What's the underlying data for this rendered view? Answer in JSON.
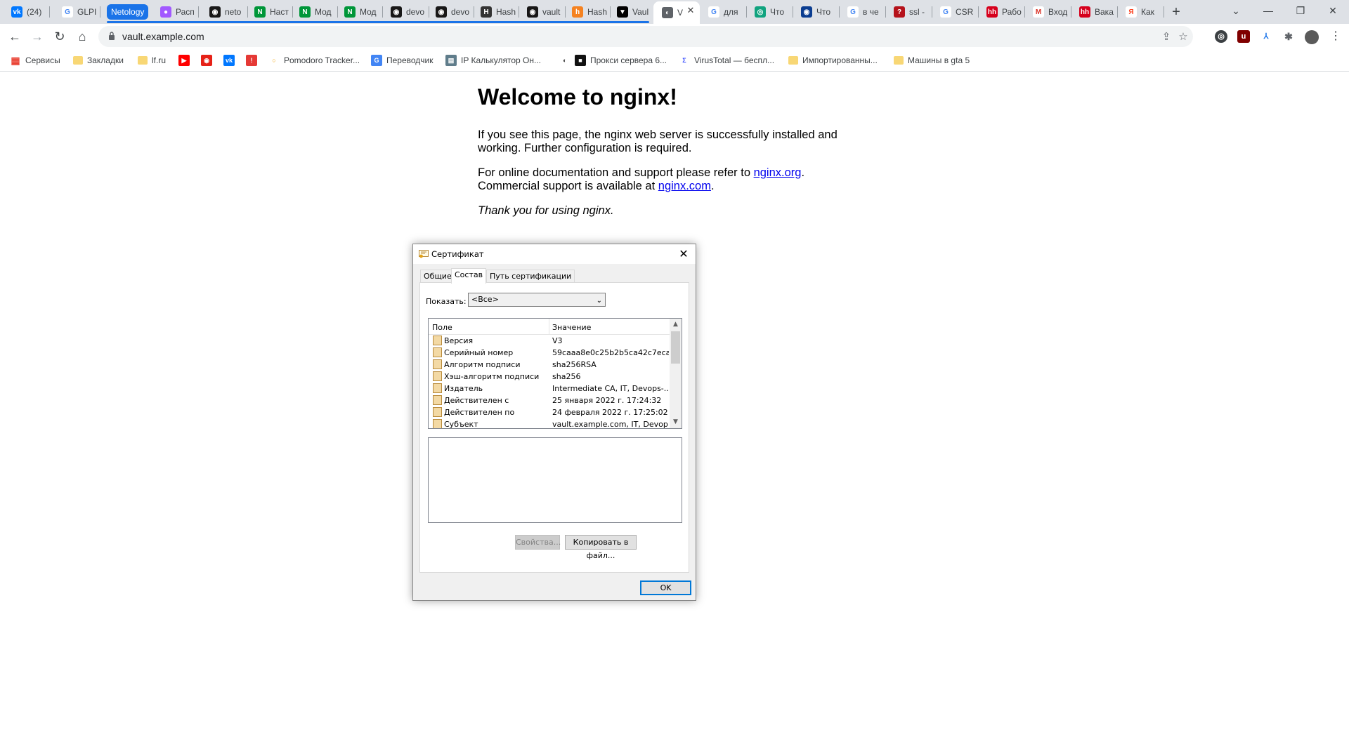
{
  "browser": {
    "tabs": [
      {
        "label": "(24)",
        "icon": "vk-icon",
        "color": "#0077ff",
        "glyph": "vk"
      },
      {
        "label": "GLPI",
        "icon": "google-icon",
        "color": "#ffffff",
        "glyph": "G"
      },
      {
        "label": "Расп",
        "icon": "figma-icon",
        "color": "#a259ff",
        "glyph": "●"
      },
      {
        "label": "neto",
        "icon": "github-icon",
        "color": "#181717",
        "glyph": "◉"
      },
      {
        "label": "Наст",
        "icon": "nginx-icon",
        "color": "#009639",
        "glyph": "N"
      },
      {
        "label": "Мод",
        "icon": "nginx-icon",
        "color": "#009639",
        "glyph": "N"
      },
      {
        "label": "Мод",
        "icon": "nginx-icon",
        "color": "#009639",
        "glyph": "N"
      },
      {
        "label": "devo",
        "icon": "github-icon",
        "color": "#181717",
        "glyph": "◉"
      },
      {
        "label": "devo",
        "icon": "github-icon",
        "color": "#181717",
        "glyph": "◉"
      },
      {
        "label": "Hash",
        "icon": "hashicorp-icon",
        "color": "#333333",
        "glyph": "H"
      },
      {
        "label": "vault",
        "icon": "github-icon",
        "color": "#181717",
        "glyph": "◉"
      },
      {
        "label": "Hash",
        "icon": "habr-icon",
        "color": "#f58220",
        "glyph": "h"
      },
      {
        "label": "Vaul",
        "icon": "vault-icon",
        "color": "#000000",
        "glyph": "▼"
      },
      {
        "label": "V",
        "icon": "globe-icon",
        "color": "#5f6368",
        "glyph": "◐",
        "active": true
      },
      {
        "label": "для",
        "icon": "google-icon",
        "color": "#ffffff",
        "glyph": "G"
      },
      {
        "label": "Что",
        "icon": "chatgpt-icon",
        "color": "#10a37f",
        "glyph": "◎"
      },
      {
        "label": "Что",
        "icon": "eye-icon",
        "color": "#0b3d91",
        "glyph": "◉"
      },
      {
        "label": "в че",
        "icon": "google-icon",
        "color": "#ffffff",
        "glyph": "G"
      },
      {
        "label": "ssl -",
        "icon": "question-icon",
        "color": "#b5121b",
        "glyph": "?"
      },
      {
        "label": "CSR",
        "icon": "google-icon",
        "color": "#ffffff",
        "glyph": "G"
      },
      {
        "label": "Рабо",
        "icon": "hh-icon",
        "color": "#d6001c",
        "glyph": "hh"
      },
      {
        "label": "Вход",
        "icon": "gmail-icon",
        "color": "#ffffff",
        "glyph": "M"
      },
      {
        "label": "Вака",
        "icon": "hh-icon",
        "color": "#d6001c",
        "glyph": "hh"
      },
      {
        "label": "Как",
        "icon": "yandex-icon",
        "color": "#ffffff",
        "glyph": "Я"
      }
    ],
    "group_label": "Netology",
    "url": "vault.example.com",
    "bookmarks": [
      {
        "label": "Сервисы",
        "icon": "apps-grid-icon"
      },
      {
        "label": "Закладки",
        "icon": "folder-icon"
      },
      {
        "label": "lf.ru",
        "icon": "folder-icon"
      },
      {
        "label": "",
        "icon": "youtube-icon"
      },
      {
        "label": "",
        "icon": "play-icon"
      },
      {
        "label": "",
        "icon": "vk-icon"
      },
      {
        "label": "",
        "icon": "alert-icon"
      },
      {
        "label": "Pomodoro Tracker...",
        "icon": "pomodoro-icon"
      },
      {
        "label": "Переводчик",
        "icon": "translate-icon"
      },
      {
        "label": "IP Калькулятор Он...",
        "icon": "network-icon"
      },
      {
        "label": "",
        "icon": "globe-icon"
      },
      {
        "label": "Прокси сервера 6...",
        "icon": "proxy-icon"
      },
      {
        "label": "VirusTotal — беспл...",
        "icon": "virustotal-icon"
      },
      {
        "label": "Импортированны...",
        "icon": "folder-icon"
      },
      {
        "label": "Машины в gta 5",
        "icon": "folder-icon"
      }
    ]
  },
  "page": {
    "title": "Welcome to nginx!",
    "p1": "If you see this page, the nginx web server is successfully installed and working. Further configuration is required.",
    "p2_before": "For online documentation and support please refer to ",
    "p2_link1": "nginx.org",
    "p2_mid": ". Commercial support is available at ",
    "p2_link2": "nginx.com",
    "p2_after": ".",
    "p3": "Thank you for using nginx."
  },
  "dialog": {
    "title": "Сертификат",
    "tabs": [
      "Общие",
      "Состав",
      "Путь сертификации"
    ],
    "active_tab": "Состав",
    "show_label": "Показать:",
    "show_value": "<Все>",
    "columns": {
      "field": "Поле",
      "value": "Значение"
    },
    "rows": [
      {
        "field": "Версия",
        "value": "V3"
      },
      {
        "field": "Серийный номер",
        "value": "59caaa8e0c25b2b5ca42c7eca..."
      },
      {
        "field": "Алгоритм подписи",
        "value": "sha256RSA"
      },
      {
        "field": "Хэш-алгоритм подписи",
        "value": "sha256"
      },
      {
        "field": "Издатель",
        "value": "Intermediate CA, IT, Devops-..."
      },
      {
        "field": "Действителен с",
        "value": "25 января 2022 г. 17:24:32"
      },
      {
        "field": "Действителен по",
        "value": "24 февраля 2022 г. 17:25:02"
      },
      {
        "field": "Субъект",
        "value": "vault.example.com, IT, Devop..."
      }
    ],
    "properties_button": "Свойства...",
    "copy_button": "Копировать в файл...",
    "ok_button": "OK"
  }
}
